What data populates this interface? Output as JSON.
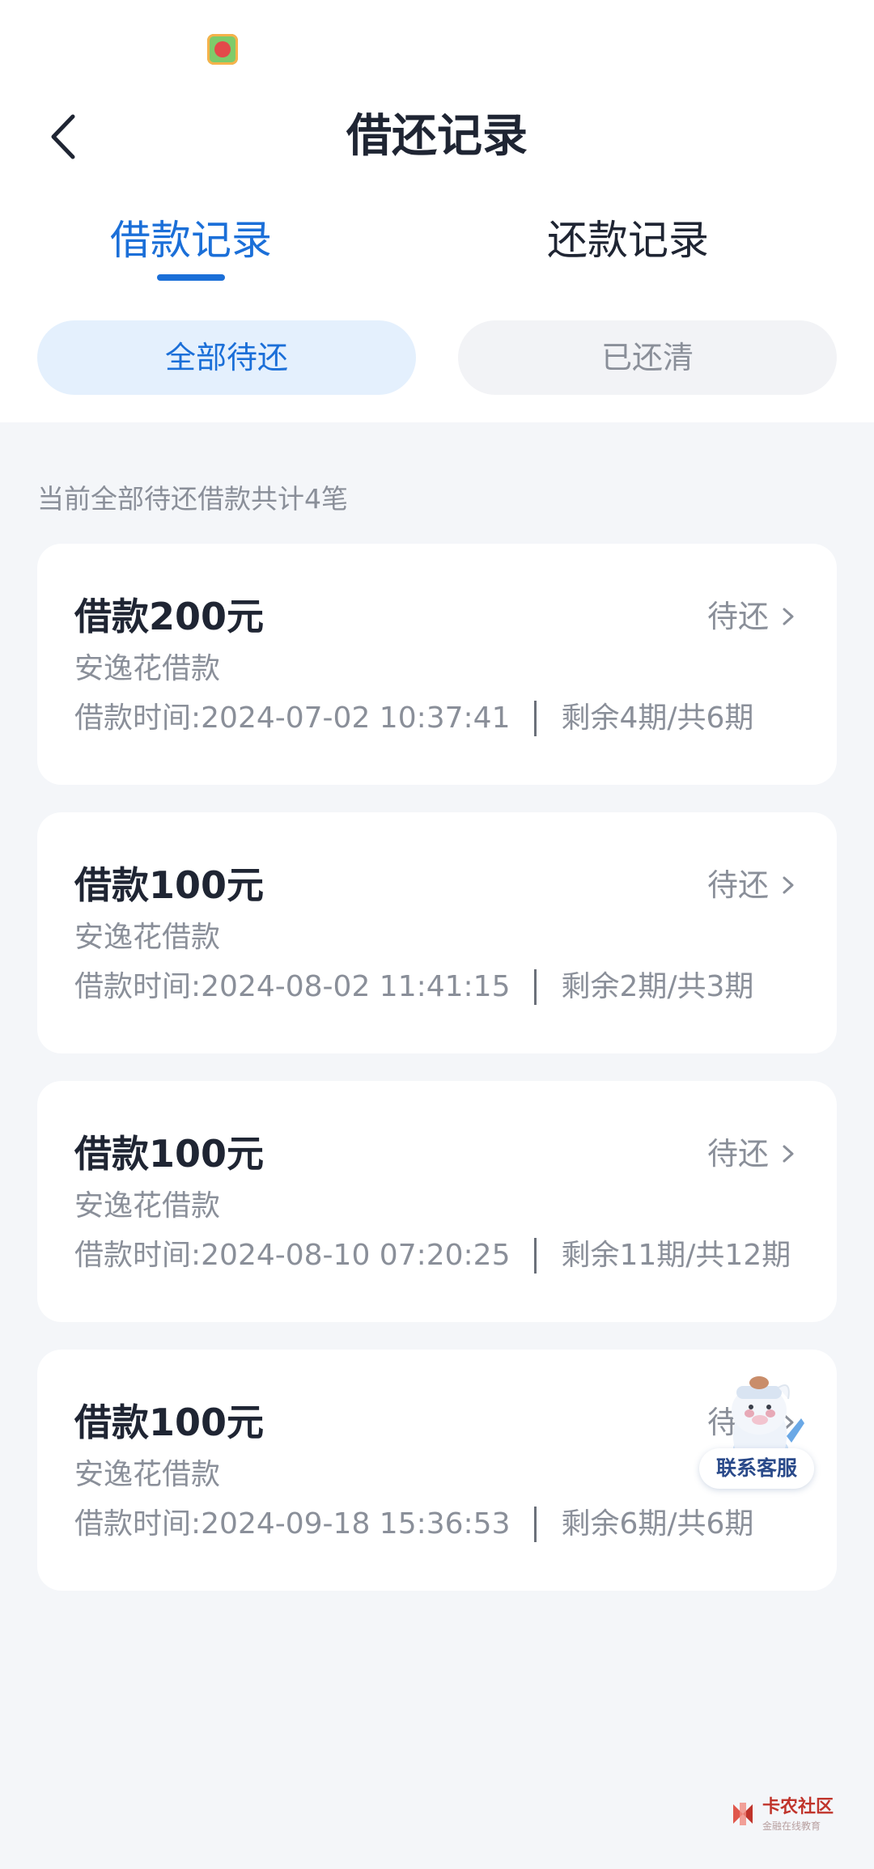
{
  "header": {
    "title": "借还记录"
  },
  "tabs": [
    {
      "label": "借款记录",
      "active": true
    },
    {
      "label": "还款记录",
      "active": false
    }
  ],
  "filters": [
    {
      "label": "全部待还",
      "active": true
    },
    {
      "label": "已还清",
      "active": false
    }
  ],
  "summary": "当前全部待还借款共计4笔",
  "loans": [
    {
      "amount": "借款200元",
      "product": "安逸花借款",
      "time": "借款时间:2024-07-02 10:37:41",
      "installments": "剩余4期/共6期",
      "status": "待还"
    },
    {
      "amount": "借款100元",
      "product": "安逸花借款",
      "time": "借款时间:2024-08-02 11:41:15",
      "installments": "剩余2期/共3期",
      "status": "待还"
    },
    {
      "amount": "借款100元",
      "product": "安逸花借款",
      "time": "借款时间:2024-08-10 07:20:25",
      "installments": "剩余11期/共12期",
      "status": "待还"
    },
    {
      "amount": "借款100元",
      "product": "安逸花借款",
      "time": "借款时间:2024-09-18 15:36:53",
      "installments": "剩余6期/共6期",
      "status": "待还"
    }
  ],
  "customer_service": {
    "label": "联系客服"
  },
  "watermark": {
    "text": "卡农社区",
    "sub": "金融在线教育"
  },
  "colors": {
    "accent": "#1b6fd8",
    "pill_active_bg": "#e4f0fd",
    "page_bg": "#f4f6f9"
  }
}
